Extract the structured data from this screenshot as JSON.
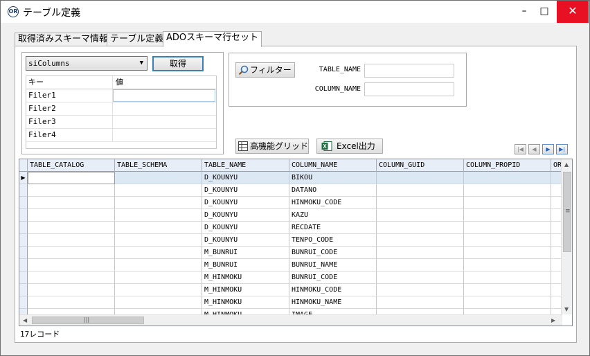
{
  "window": {
    "title": "テーブル定義",
    "icon_text": "OR",
    "controls": {
      "minimize": "–",
      "maximize": "□",
      "close": "✕"
    }
  },
  "tabs": [
    {
      "label": "取得済みスキーマ情報",
      "active": false
    },
    {
      "label": "テーブル定義",
      "active": false
    },
    {
      "label": "ADOスキーマ行セット",
      "active": true
    }
  ],
  "schema_select": {
    "value": "siColumns"
  },
  "fetch_button": {
    "label": "取得"
  },
  "restrictions": {
    "headers": {
      "key": "キー",
      "value": "値"
    },
    "rows": [
      {
        "key": "Filer1",
        "value": ""
      },
      {
        "key": "Filer2",
        "value": ""
      },
      {
        "key": "Filer3",
        "value": ""
      },
      {
        "key": "Filer4",
        "value": ""
      }
    ]
  },
  "filter": {
    "button_label": "フィルター",
    "table_name_label": "TABLE_NAME",
    "table_name_value": "",
    "column_name_label": "COLUMN_NAME",
    "column_name_value": ""
  },
  "toolbar": {
    "high_grid_label": "高機能グリッド",
    "excel_label": "Excel出力"
  },
  "navigator": {
    "first": "|◀",
    "prev": "◀",
    "next": "▶",
    "last": "▶|"
  },
  "grid": {
    "columns": [
      "TABLE_CATALOG",
      "TABLE_SCHEMA",
      "TABLE_NAME",
      "COLUMN_NAME",
      "COLUMN_GUID",
      "COLUMN_PROPID",
      "OR"
    ],
    "rows": [
      [
        "",
        "",
        "D_KOUNYU",
        "BIKOU",
        "",
        "",
        ""
      ],
      [
        "",
        "",
        "D_KOUNYU",
        "DATANO",
        "",
        "",
        ""
      ],
      [
        "",
        "",
        "D_KOUNYU",
        "HINMOKU_CODE",
        "",
        "",
        ""
      ],
      [
        "",
        "",
        "D_KOUNYU",
        "KAZU",
        "",
        "",
        ""
      ],
      [
        "",
        "",
        "D_KOUNYU",
        "RECDATE",
        "",
        "",
        ""
      ],
      [
        "",
        "",
        "D_KOUNYU",
        "TENPO_CODE",
        "",
        "",
        ""
      ],
      [
        "",
        "",
        "M_BUNRUI",
        "BUNRUI_CODE",
        "",
        "",
        ""
      ],
      [
        "",
        "",
        "M_BUNRUI",
        "BUNRUI_NAME",
        "",
        "",
        ""
      ],
      [
        "",
        "",
        "M_HINMOKU",
        "BUNRUI_CODE",
        "",
        "",
        ""
      ],
      [
        "",
        "",
        "M_HINMOKU",
        "HINMOKU_CODE",
        "",
        "",
        ""
      ],
      [
        "",
        "",
        "M_HINMOKU",
        "HINMOKU_NAME",
        "",
        "",
        ""
      ],
      [
        "",
        "",
        "M_HINMOKU",
        "IMAGE",
        "",
        "",
        ""
      ]
    ],
    "current_row_marker": "▶"
  },
  "status": {
    "record_count": "17レコード"
  }
}
